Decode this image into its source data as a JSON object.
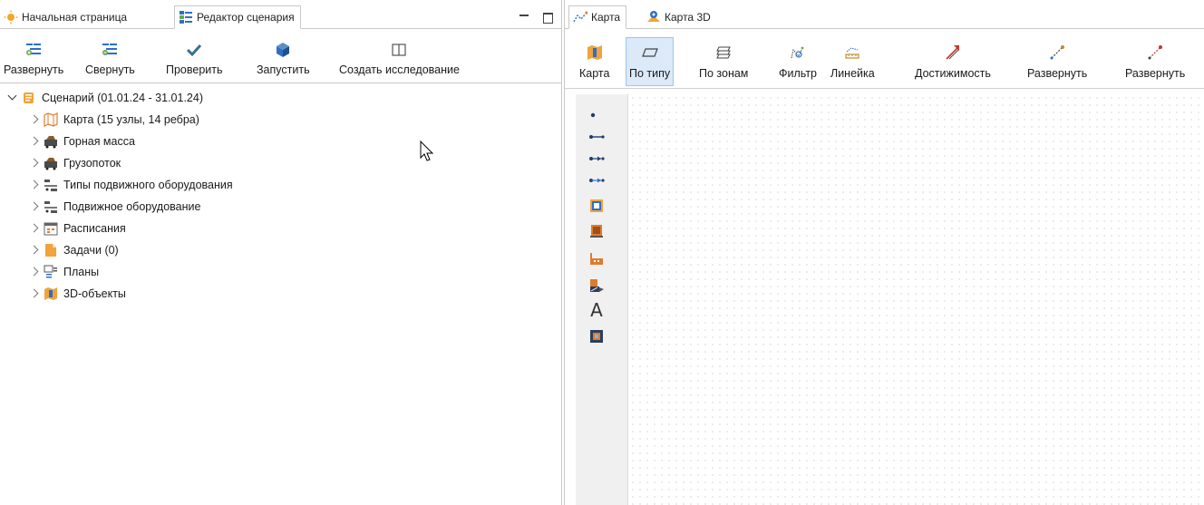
{
  "left_tabs": [
    {
      "label": "Начальная страница"
    },
    {
      "label": "Редактор сценария"
    }
  ],
  "left_toolbar": [
    {
      "label": "Развернуть",
      "icon": "expand-tree-icon"
    },
    {
      "label": "Свернуть",
      "icon": "collapse-tree-icon"
    },
    {
      "label": "Проверить",
      "icon": "checkmark-icon"
    },
    {
      "label": "Запустить",
      "icon": "cube-run-icon"
    },
    {
      "label": "Создать исследование",
      "icon": "book-icon"
    }
  ],
  "tree": {
    "root": {
      "label": "Сценарий (01.01.24 - 31.01.24)",
      "expanded": true
    },
    "children": [
      {
        "label": "Карта (15 узлы, 14 ребра)",
        "icon": "map-icon"
      },
      {
        "label": "Горная масса",
        "icon": "rock-mass-icon"
      },
      {
        "label": "Грузопоток",
        "icon": "cargo-flow-icon"
      },
      {
        "label": "Типы подвижного оборудования",
        "icon": "equipment-types-icon"
      },
      {
        "label": "Подвижное оборудование",
        "icon": "mobile-equipment-icon"
      },
      {
        "label": "Расписания",
        "icon": "schedule-icon"
      },
      {
        "label": "Задачи (0)",
        "icon": "tasks-icon"
      },
      {
        "label": "Планы",
        "icon": "plans-icon"
      },
      {
        "label": "3D-объекты",
        "icon": "3d-objects-icon"
      }
    ]
  },
  "right_tabs": [
    {
      "label": "Карта"
    },
    {
      "label": "Карта 3D"
    }
  ],
  "right_toolbar": [
    {
      "label": "Карта",
      "icon": "map-icon",
      "active": false
    },
    {
      "label": "По типу",
      "icon": "by-type-icon",
      "active": true
    },
    {
      "label": "По зонам",
      "icon": "by-zones-icon",
      "active": false
    },
    {
      "label": "Фильтр",
      "icon": "filter-icon",
      "active": false
    },
    {
      "label": "Линейка",
      "icon": "ruler-icon",
      "active": false
    },
    {
      "label": "Достижимость",
      "icon": "reachability-icon",
      "active": false
    },
    {
      "label": "Развернуть",
      "icon": "expand-route-icon",
      "active": false
    },
    {
      "label": "Развернуть",
      "icon": "expand-route-red-icon",
      "active": false
    }
  ],
  "palette": [
    {
      "icon": "node-dot-icon"
    },
    {
      "icon": "edge-icon"
    },
    {
      "icon": "directed-edge-icon"
    },
    {
      "icon": "bidirectional-edge-icon"
    },
    {
      "icon": "loading-point-icon"
    },
    {
      "icon": "unloading-point-icon"
    },
    {
      "icon": "factory-icon"
    },
    {
      "icon": "storage-icon"
    },
    {
      "icon": "text-label-icon",
      "glyph": "A"
    },
    {
      "icon": "3d-object-icon"
    }
  ],
  "colors": {
    "accent_blue": "#2d6fc4",
    "active_button_bg": "#dbe9f8",
    "orange": "#e07b2a",
    "red": "#c0392b"
  }
}
